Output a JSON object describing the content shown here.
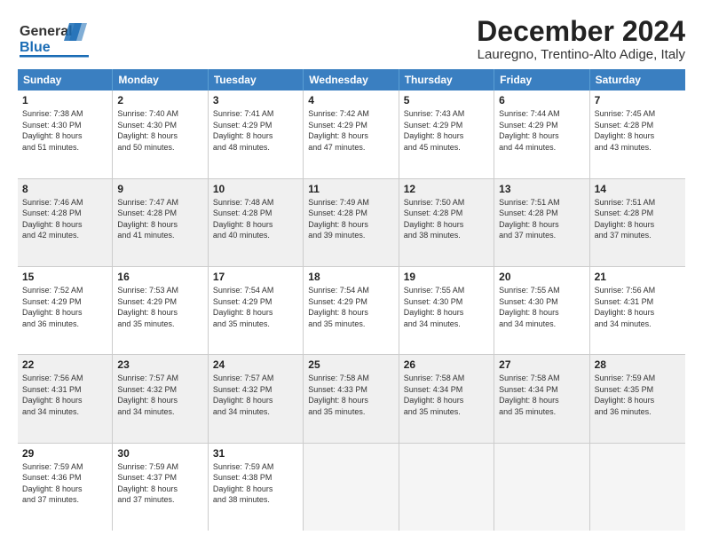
{
  "logo": {
    "line1": "General",
    "line2": "Blue"
  },
  "title": "December 2024",
  "subtitle": "Lauregno, Trentino-Alto Adige, Italy",
  "days": [
    "Sunday",
    "Monday",
    "Tuesday",
    "Wednesday",
    "Thursday",
    "Friday",
    "Saturday"
  ],
  "weeks": [
    [
      {
        "day": "1",
        "info": "Sunrise: 7:38 AM\nSunset: 4:30 PM\nDaylight: 8 hours\nand 51 minutes.",
        "shaded": false
      },
      {
        "day": "2",
        "info": "Sunrise: 7:40 AM\nSunset: 4:30 PM\nDaylight: 8 hours\nand 50 minutes.",
        "shaded": false
      },
      {
        "day": "3",
        "info": "Sunrise: 7:41 AM\nSunset: 4:29 PM\nDaylight: 8 hours\nand 48 minutes.",
        "shaded": false
      },
      {
        "day": "4",
        "info": "Sunrise: 7:42 AM\nSunset: 4:29 PM\nDaylight: 8 hours\nand 47 minutes.",
        "shaded": false
      },
      {
        "day": "5",
        "info": "Sunrise: 7:43 AM\nSunset: 4:29 PM\nDaylight: 8 hours\nand 45 minutes.",
        "shaded": false
      },
      {
        "day": "6",
        "info": "Sunrise: 7:44 AM\nSunset: 4:29 PM\nDaylight: 8 hours\nand 44 minutes.",
        "shaded": false
      },
      {
        "day": "7",
        "info": "Sunrise: 7:45 AM\nSunset: 4:28 PM\nDaylight: 8 hours\nand 43 minutes.",
        "shaded": false
      }
    ],
    [
      {
        "day": "8",
        "info": "Sunrise: 7:46 AM\nSunset: 4:28 PM\nDaylight: 8 hours\nand 42 minutes.",
        "shaded": true
      },
      {
        "day": "9",
        "info": "Sunrise: 7:47 AM\nSunset: 4:28 PM\nDaylight: 8 hours\nand 41 minutes.",
        "shaded": true
      },
      {
        "day": "10",
        "info": "Sunrise: 7:48 AM\nSunset: 4:28 PM\nDaylight: 8 hours\nand 40 minutes.",
        "shaded": true
      },
      {
        "day": "11",
        "info": "Sunrise: 7:49 AM\nSunset: 4:28 PM\nDaylight: 8 hours\nand 39 minutes.",
        "shaded": true
      },
      {
        "day": "12",
        "info": "Sunrise: 7:50 AM\nSunset: 4:28 PM\nDaylight: 8 hours\nand 38 minutes.",
        "shaded": true
      },
      {
        "day": "13",
        "info": "Sunrise: 7:51 AM\nSunset: 4:28 PM\nDaylight: 8 hours\nand 37 minutes.",
        "shaded": true
      },
      {
        "day": "14",
        "info": "Sunrise: 7:51 AM\nSunset: 4:28 PM\nDaylight: 8 hours\nand 37 minutes.",
        "shaded": true
      }
    ],
    [
      {
        "day": "15",
        "info": "Sunrise: 7:52 AM\nSunset: 4:29 PM\nDaylight: 8 hours\nand 36 minutes.",
        "shaded": false
      },
      {
        "day": "16",
        "info": "Sunrise: 7:53 AM\nSunset: 4:29 PM\nDaylight: 8 hours\nand 35 minutes.",
        "shaded": false
      },
      {
        "day": "17",
        "info": "Sunrise: 7:54 AM\nSunset: 4:29 PM\nDaylight: 8 hours\nand 35 minutes.",
        "shaded": false
      },
      {
        "day": "18",
        "info": "Sunrise: 7:54 AM\nSunset: 4:29 PM\nDaylight: 8 hours\nand 35 minutes.",
        "shaded": false
      },
      {
        "day": "19",
        "info": "Sunrise: 7:55 AM\nSunset: 4:30 PM\nDaylight: 8 hours\nand 34 minutes.",
        "shaded": false
      },
      {
        "day": "20",
        "info": "Sunrise: 7:55 AM\nSunset: 4:30 PM\nDaylight: 8 hours\nand 34 minutes.",
        "shaded": false
      },
      {
        "day": "21",
        "info": "Sunrise: 7:56 AM\nSunset: 4:31 PM\nDaylight: 8 hours\nand 34 minutes.",
        "shaded": false
      }
    ],
    [
      {
        "day": "22",
        "info": "Sunrise: 7:56 AM\nSunset: 4:31 PM\nDaylight: 8 hours\nand 34 minutes.",
        "shaded": true
      },
      {
        "day": "23",
        "info": "Sunrise: 7:57 AM\nSunset: 4:32 PM\nDaylight: 8 hours\nand 34 minutes.",
        "shaded": true
      },
      {
        "day": "24",
        "info": "Sunrise: 7:57 AM\nSunset: 4:32 PM\nDaylight: 8 hours\nand 34 minutes.",
        "shaded": true
      },
      {
        "day": "25",
        "info": "Sunrise: 7:58 AM\nSunset: 4:33 PM\nDaylight: 8 hours\nand 35 minutes.",
        "shaded": true
      },
      {
        "day": "26",
        "info": "Sunrise: 7:58 AM\nSunset: 4:34 PM\nDaylight: 8 hours\nand 35 minutes.",
        "shaded": true
      },
      {
        "day": "27",
        "info": "Sunrise: 7:58 AM\nSunset: 4:34 PM\nDaylight: 8 hours\nand 35 minutes.",
        "shaded": true
      },
      {
        "day": "28",
        "info": "Sunrise: 7:59 AM\nSunset: 4:35 PM\nDaylight: 8 hours\nand 36 minutes.",
        "shaded": true
      }
    ],
    [
      {
        "day": "29",
        "info": "Sunrise: 7:59 AM\nSunset: 4:36 PM\nDaylight: 8 hours\nand 37 minutes.",
        "shaded": false
      },
      {
        "day": "30",
        "info": "Sunrise: 7:59 AM\nSunset: 4:37 PM\nDaylight: 8 hours\nand 37 minutes.",
        "shaded": false
      },
      {
        "day": "31",
        "info": "Sunrise: 7:59 AM\nSunset: 4:38 PM\nDaylight: 8 hours\nand 38 minutes.",
        "shaded": false
      },
      {
        "day": "",
        "info": "",
        "shaded": false,
        "empty": true
      },
      {
        "day": "",
        "info": "",
        "shaded": false,
        "empty": true
      },
      {
        "day": "",
        "info": "",
        "shaded": false,
        "empty": true
      },
      {
        "day": "",
        "info": "",
        "shaded": false,
        "empty": true
      }
    ]
  ]
}
